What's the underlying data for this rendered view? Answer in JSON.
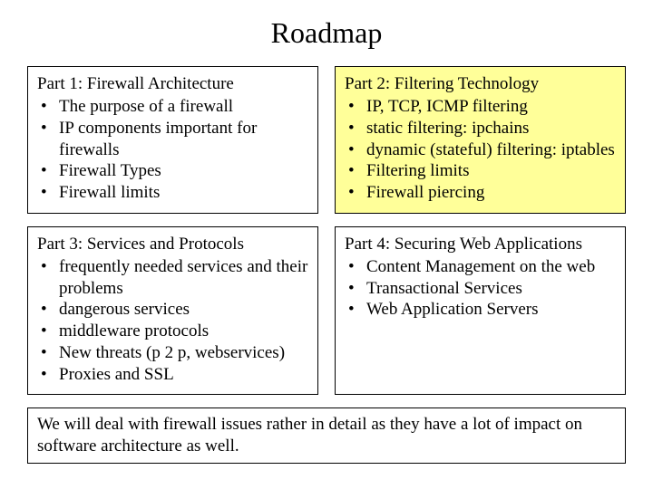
{
  "title": "Roadmap",
  "parts": [
    {
      "heading": "Part 1: Firewall Architecture",
      "highlight": false,
      "items": [
        "The purpose of a firewall",
        "IP components important for firewalls",
        "Firewall Types",
        "Firewall limits"
      ]
    },
    {
      "heading": "Part 2: Filtering Technology",
      "highlight": true,
      "items": [
        "IP, TCP, ICMP filtering",
        "static filtering: ipchains",
        "dynamic (stateful) filtering: iptables",
        "Filtering limits",
        "Firewall piercing"
      ]
    },
    {
      "heading": "Part 3: Services and Protocols",
      "highlight": false,
      "items": [
        "frequently needed services and their problems",
        "dangerous services",
        "middleware protocols",
        "New threats (p 2 p, webservices)",
        "Proxies and SSL"
      ]
    },
    {
      "heading": "Part 4: Securing Web Applications",
      "highlight": false,
      "items": [
        "Content Management on the web",
        "Transactional Services",
        "Web Application Servers"
      ]
    }
  ],
  "footnote": "We will deal with firewall issues rather in detail as they have a lot of impact on software architecture as well."
}
